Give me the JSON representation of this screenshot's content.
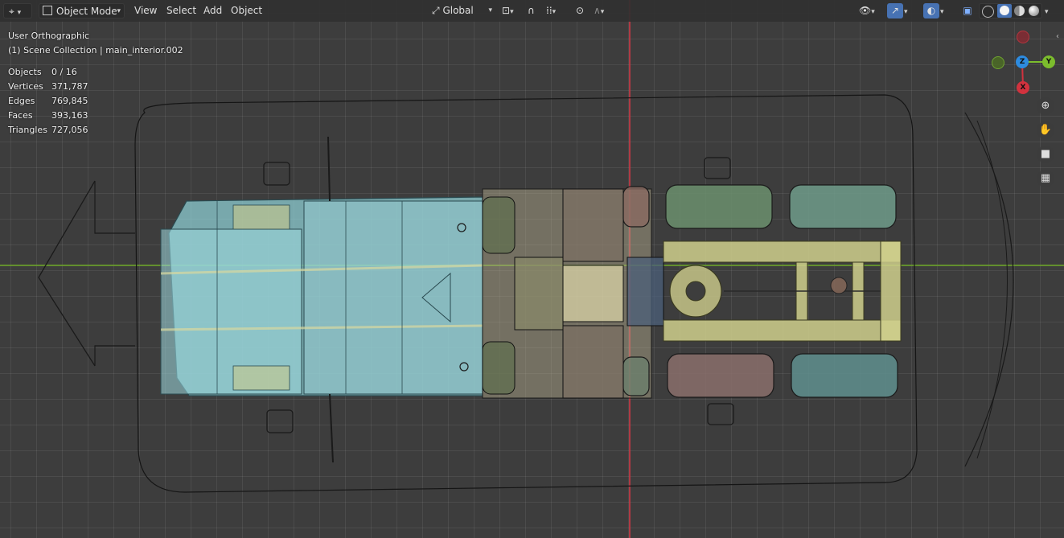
{
  "header": {
    "editor_type_icon": "3d-viewport-icon",
    "mode_label": "Object Mode",
    "menus": [
      "View",
      "Select",
      "Add",
      "Object"
    ],
    "transform_orientation": "Global"
  },
  "overlay": {
    "view_name": "User Orthographic",
    "collection_line": "(1) Scene Collection | main_interior.002"
  },
  "stats": [
    {
      "label": "Objects",
      "value": "0 / 16"
    },
    {
      "label": "Vertices",
      "value": "371,787"
    },
    {
      "label": "Edges",
      "value": "769,845"
    },
    {
      "label": "Faces",
      "value": "393,163"
    },
    {
      "label": "Triangles",
      "value": "727,056"
    }
  ],
  "gizmo": {
    "z_label": "Z",
    "y_label": "Y",
    "x_label": "X"
  },
  "colors": {
    "x_axis": "#d1323e",
    "y_axis": "#7cbd2d",
    "z_axis": "#2d8be0",
    "cab": "#8fd1d7",
    "chassis": "#cfcf8c",
    "accent": "#4772b3"
  }
}
